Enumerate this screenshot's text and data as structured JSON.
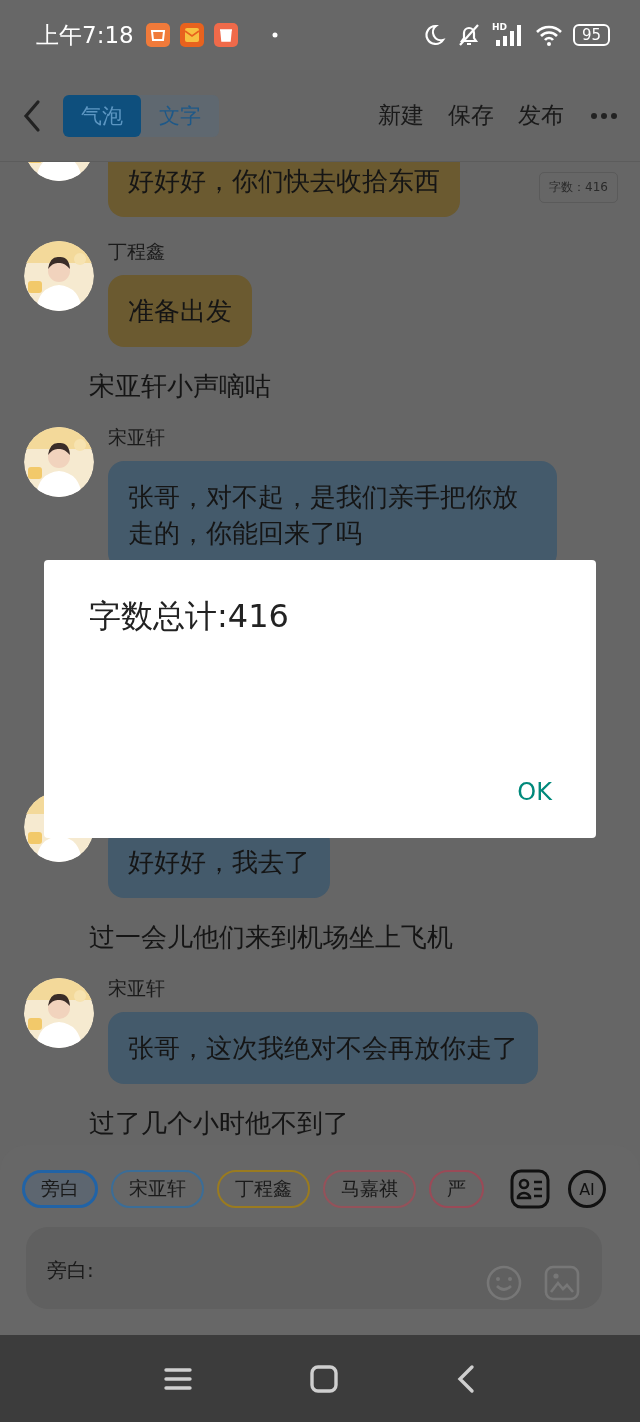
{
  "status_bar": {
    "time": "上午7:18",
    "network": "HD",
    "battery": "95"
  },
  "header": {
    "tabs": [
      {
        "label": "气泡",
        "selected": true
      },
      {
        "label": "文字",
        "selected": false
      }
    ],
    "actions": [
      "新建",
      "保存",
      "发布"
    ]
  },
  "word_count_badge": "字数：416",
  "chat": [
    {
      "kind": "message",
      "text": "好好好，你们快去收拾东西",
      "color": "#6b5a30"
    },
    {
      "kind": "message",
      "name": "丁程鑫",
      "text": "准备出发",
      "color": "#6b5a30"
    },
    {
      "kind": "narration",
      "text": "宋亚轩小声嘀咕"
    },
    {
      "kind": "message",
      "name": "宋亚轩",
      "text": "张哥，对不起，是我们亲手把你放走的，你能回来了吗",
      "color": "#445a6b"
    },
    {
      "kind": "message",
      "text": "好好好，我去了",
      "color": "#445a6b"
    },
    {
      "kind": "narration",
      "text": "过一会儿他们来到机场坐上飞机"
    },
    {
      "kind": "message",
      "name": "宋亚轩",
      "text": "张哥，这次我绝对不会再放你走了",
      "color": "#445a6b"
    },
    {
      "kind": "narration",
      "text": "过了几个小时他不到了"
    }
  ],
  "chips": [
    {
      "label": "旁白",
      "selected": true,
      "color": "#2163a6"
    },
    {
      "label": "宋亚轩",
      "selected": false,
      "color": "#3b6d97"
    },
    {
      "label": "丁程鑫",
      "selected": false,
      "color": "#9a7b1f"
    },
    {
      "label": "马嘉祺",
      "selected": false,
      "color": "#94525a"
    },
    {
      "label": "严",
      "selected": false,
      "color": "#9a4a57"
    }
  ],
  "ai_button": "AI",
  "input": {
    "label": "旁白:"
  },
  "dialog": {
    "message": "字数总计:416",
    "button": "OK"
  }
}
